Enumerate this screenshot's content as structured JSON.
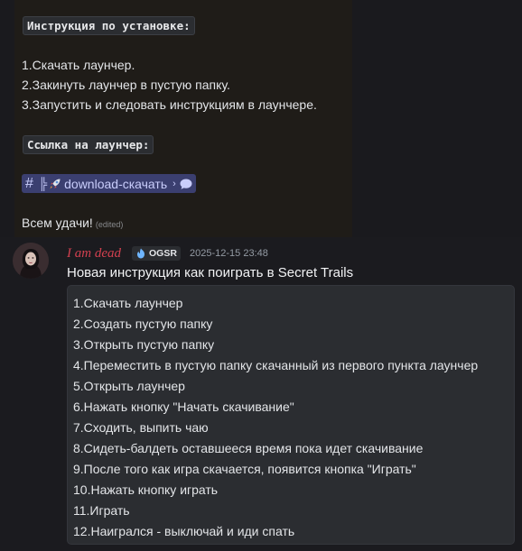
{
  "prev_message": {
    "header_code": "Инструкция по установке:",
    "steps": [
      "1.Скачать лаунчер.",
      "2.Закинуть лаунчер в пустую папку.",
      "3.Запустить и следовать инструкциям в лаунчере."
    ],
    "link_code": "Ссылка на лаунчер:",
    "channel": {
      "prefix": "╠",
      "name": "download-скачать",
      "chevron": "›"
    },
    "closing": "Всем удачи!",
    "edited_label": "(edited)"
  },
  "message": {
    "username": "I am dead",
    "username_color": "#d2404f",
    "tag": "OGSR",
    "timestamp": "2025-12-15 23:48",
    "text": "Новая инструкция как поиграть в Secret Trails",
    "code_lines": [
      "1.Скачать лаунчер",
      "2.Создать пустую папку",
      "3.Открыть пустую папку",
      "4.Переместить в пустую папку скачанный из первого пункта лаунчер",
      "5.Открыть лаунчер",
      "6.Нажать кнопку \"Начать скачивание\"",
      "7.Сходить, выпить чаю",
      "8.Сидеть-балдеть оставшееся время пока идет скачивание",
      "9.После того как игра скачается, появится кнопка \"Играть\"",
      "10.Нажать кнопку играть",
      "11.Играть",
      "12.Наигрался - выключай и иди спать"
    ]
  }
}
